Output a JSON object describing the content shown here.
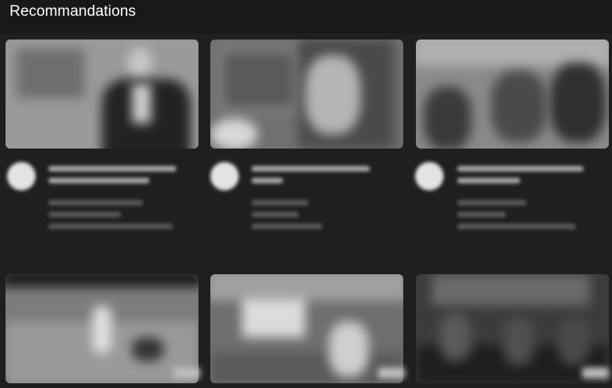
{
  "section": {
    "title": "Recommandations"
  }
}
